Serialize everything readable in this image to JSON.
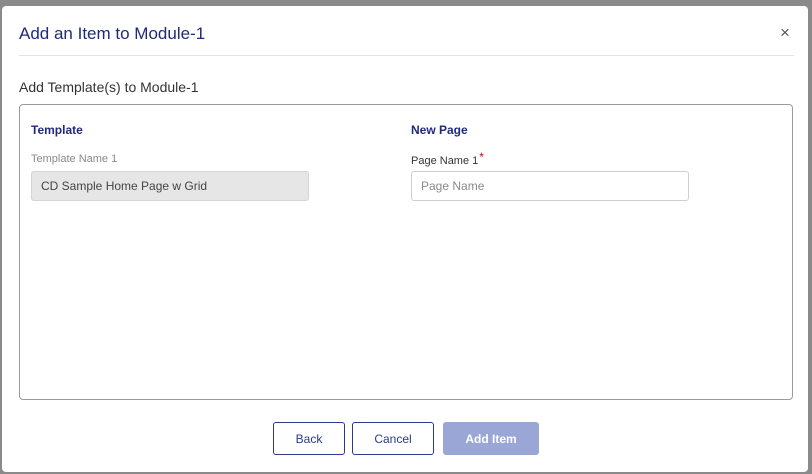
{
  "dialog": {
    "title": "Add an Item to Module-1",
    "close_glyph": "×",
    "section_heading": "Add Template(s) to Module-1"
  },
  "template_column": {
    "heading": "Template",
    "field_label": "Template Name 1",
    "field_value": "CD Sample Home Page w Grid"
  },
  "new_page_column": {
    "heading": "New Page",
    "field_label": "Page Name 1",
    "required_marker": "*",
    "input_value": "",
    "input_placeholder": "Page Name"
  },
  "footer": {
    "back_label": "Back",
    "cancel_label": "Cancel",
    "add_item_label": "Add Item"
  },
  "colors": {
    "title": "#1f2a7a",
    "primary_disabled": "#9aa6d6",
    "outline_button": "#2a3a8f",
    "required": "#d0021b"
  },
  "icons": {
    "close": "close-icon"
  }
}
